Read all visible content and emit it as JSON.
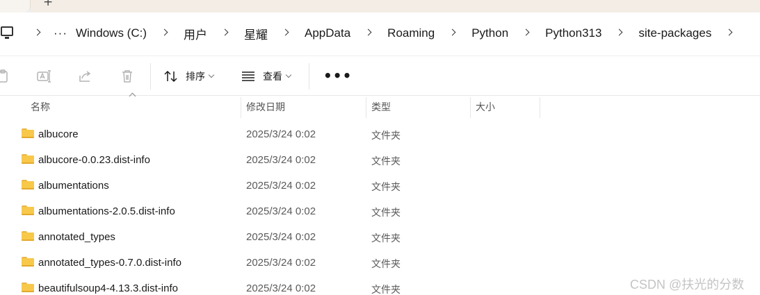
{
  "tabs": {
    "close_glyph": "✕",
    "new_tab_glyph": "+"
  },
  "breadcrumb": {
    "icon": "computer-icon",
    "more": "···",
    "items": [
      "Windows (C:)",
      "用户",
      "星耀",
      "AppData",
      "Roaming",
      "Python",
      "Python313",
      "site-packages"
    ]
  },
  "toolbar": {
    "sort_label": "排序",
    "view_label": "查看",
    "more_label": "•••"
  },
  "columns": {
    "name": "名称",
    "date_modified": "修改日期",
    "type": "类型",
    "size": "大小"
  },
  "files": [
    {
      "name": "albucore",
      "date": "2025/3/24 0:02",
      "type": "文件夹"
    },
    {
      "name": "albucore-0.0.23.dist-info",
      "date": "2025/3/24 0:02",
      "type": "文件夹"
    },
    {
      "name": "albumentations",
      "date": "2025/3/24 0:02",
      "type": "文件夹"
    },
    {
      "name": "albumentations-2.0.5.dist-info",
      "date": "2025/3/24 0:02",
      "type": "文件夹"
    },
    {
      "name": "annotated_types",
      "date": "2025/3/24 0:02",
      "type": "文件夹"
    },
    {
      "name": "annotated_types-0.7.0.dist-info",
      "date": "2025/3/24 0:02",
      "type": "文件夹"
    },
    {
      "name": "beautifulsoup4-4.13.3.dist-info",
      "date": "2025/3/24 0:02",
      "type": "文件夹"
    }
  ],
  "watermark": "CSDN @扶光的分数",
  "colors": {
    "folder": "#f8c84a",
    "toolbar_disabled": "#b4b4b4"
  }
}
